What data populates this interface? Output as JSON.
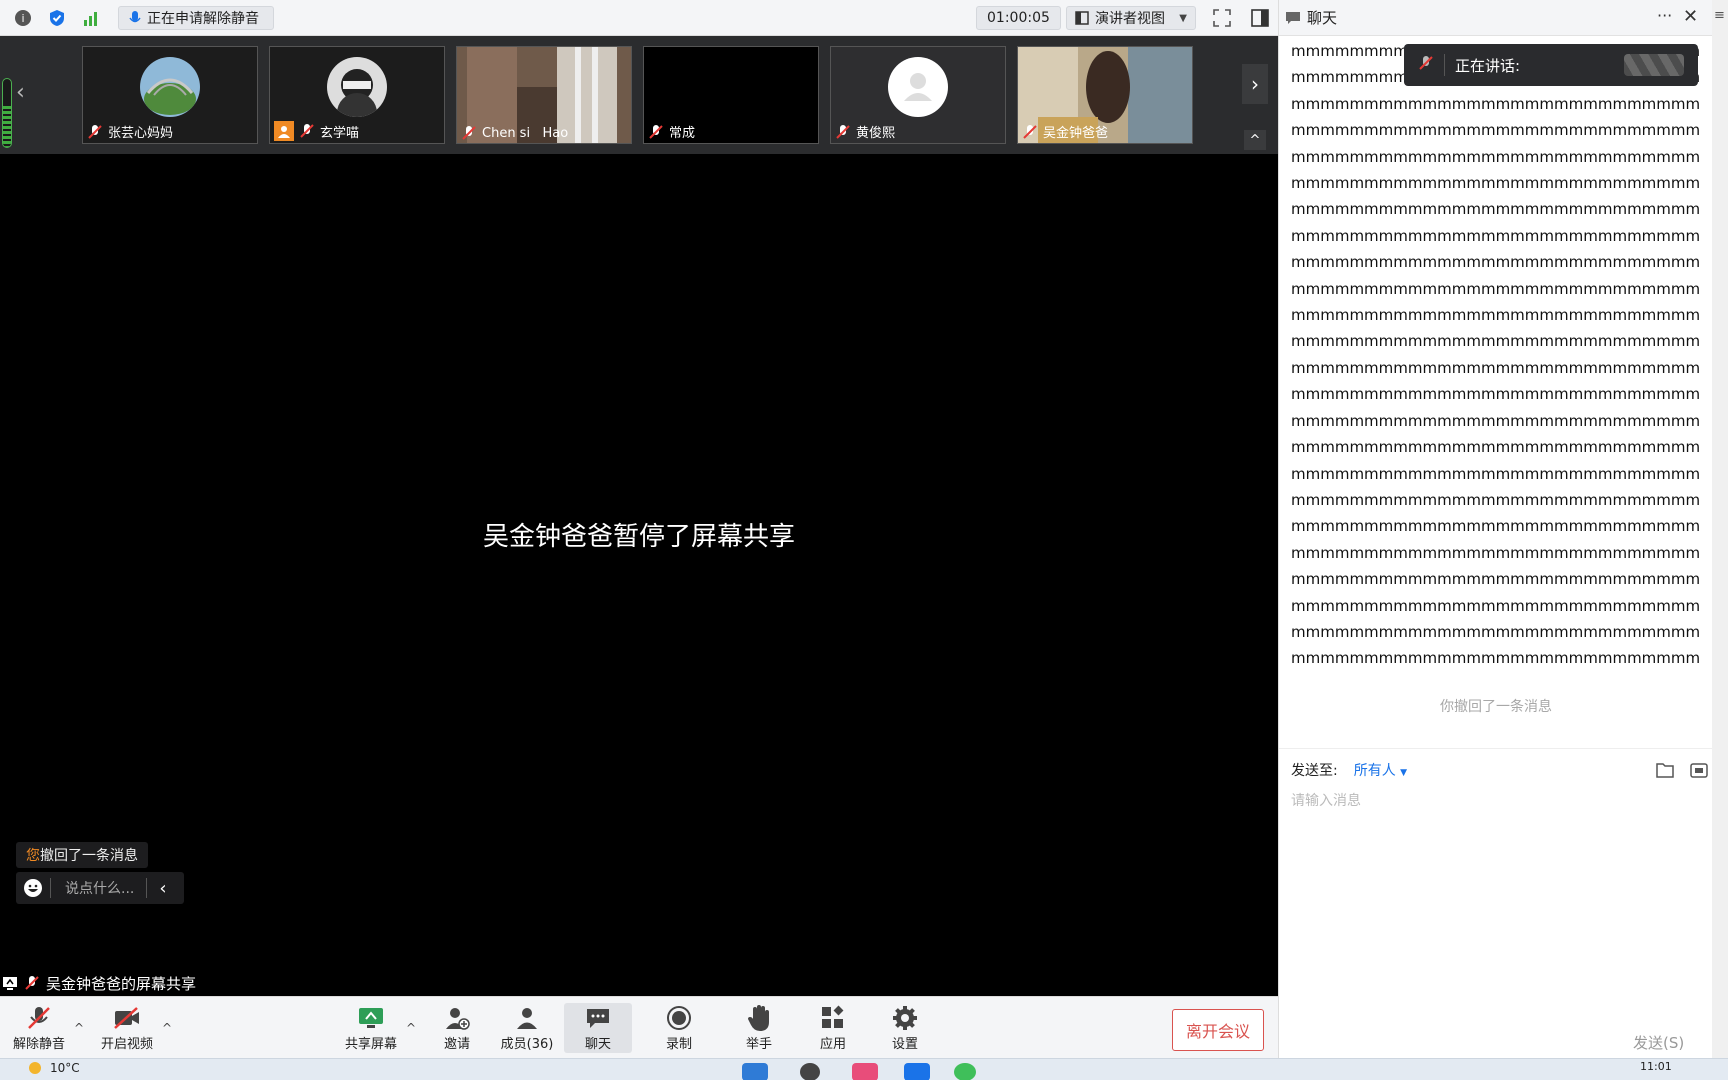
{
  "topbar": {
    "status_text": "正在申请解除静音",
    "timer": "01:00:05",
    "view_mode": "演讲者视图"
  },
  "participants": [
    {
      "name": "张芸心妈妈"
    },
    {
      "name": "玄学喵"
    },
    {
      "name": "Chen si   Hao"
    },
    {
      "name": "常成"
    },
    {
      "name": "黄俊熙"
    },
    {
      "name": "吴金钟爸爸"
    }
  ],
  "stage": {
    "pause_message": "吴金钟爸爸暂停了屏幕共享",
    "toast_you": "您",
    "toast_text": "撤回了一条消息",
    "quick_chat_placeholder": "说点什么...",
    "share_label": "吴金钟爸爸的屏幕共享"
  },
  "toolbar": {
    "unmute": "解除静音",
    "video": "开启视频",
    "share": "共享屏幕",
    "invite": "邀请",
    "members": "成员(36)",
    "chat": "聊天",
    "record": "录制",
    "raise_hand": "举手",
    "apps": "应用",
    "settings": "设置",
    "leave": "离开会议"
  },
  "chat": {
    "title": "聊天",
    "speaking_label": "正在讲话:",
    "message": "mmmmmmmmmmmmmmmmmmmmmmmmmmmmmmmmmmmmmmmmmmmmmmmmmmmmmmmmmmmmmmmmmmmmmmmmmmmmmmmmmmmmmmmmmmmmmmmmmmmmmmmmmmmmmmmmmmmmmmmmmmmmmmmmmmmmmmmmmmmmmmmmmmmmmmmmmmmmmmmmmmmmmmmmmmmmmmmmmmmmmmmmmmmmmmmmmmmmmmmmmmmmmmmmmmmmmmmmmmmmmmmmmmmmmmmmmmmmmmmmmmmmmmmmmmmmmmmmmmmmmmmmmmmmmmmmmmmmmmmmmmmmmmmmmmmmmmmmmmmmmmmmmmmmmmmmmmmmmmmmmmmmmmmmmmmmmmmmmmmmmmmmmmmmmmmmmmmmmmmmmmmmmmmmmmmmmmmmmmmmmmmmmmmmmmmmmmmmmmmmmmmmmmmmmmmmmmmmmmmmmmmmmmmmmmmmmmmmmmmmmmmmmmmmmmmmmmmmmmmmmmmmmmmmmmmmmmmmmmmmmmmmmmmmmmmmmmmmmmmmmmmmmmmmmmmmmmmmmmmmmmmmmmmmmmmmmmmmmmmmmmmmmmmmmmmmmmmmmmmmmmmmmmmmmmmmmmmmmmmmmmmmmmmmmmmmmmmmmmmmmmmmmmmmmmmmmmmmmmmmmmmmmmmmmmmmmmmmmmmmmmmmmmmmmmmmmmmmmmmmmmmmmmmmmmmmmmmmmmmmmmmmmmmmmmmmmmmmmmmmmmmmmmmmmmmmmmmmmmmmmmmmmmmmmmmmmmmmmmmmmmmmmmmmmmmmmmmmmmmmmmmmmmmmmmmmmmmmmmmmmmmm",
    "recall_notice": "你撤回了一条消息",
    "send_to_label": "发送至:",
    "send_to_target": "所有人",
    "input_placeholder": "请输入消息",
    "send_button": "发送(S)"
  },
  "taskbar": {
    "temperature": "10°C",
    "time": "11:01"
  },
  "colors": {
    "accent_blue": "#1a73e8",
    "leave_red": "#d9534f",
    "orange": "#f08a24"
  }
}
